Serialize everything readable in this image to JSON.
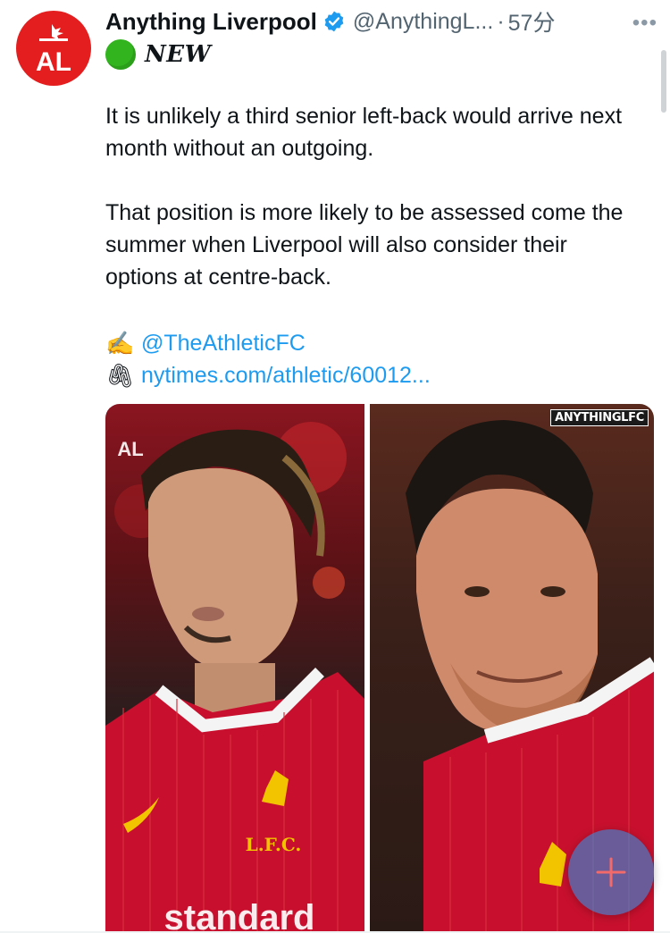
{
  "tweet": {
    "author": {
      "display_name": "Anything Liverpool",
      "handle": "@AnythingL...",
      "separator": "·",
      "time": "57分",
      "avatar_initials": "AL",
      "avatar_color": "#e41e1e"
    },
    "more_label": "•••",
    "badge_text": "NEW",
    "paragraphs": [
      "It is unlikely a third senior left-back would arrive next month without an outgoing.",
      "That position is more likely to be assessed come the summer when Liverpool will also consider their options at centre-back."
    ],
    "credit": {
      "writer_emoji": "✍️",
      "writer_link": "@TheAthleticFC",
      "link_emoji": "🖇",
      "url_text": "nytimes.com/athletic/60012..."
    },
    "media": {
      "watermark": "ANYTHINGLFC",
      "left_overlay_initials": "AL",
      "left_crest_text": "L.F.C.",
      "left_sponsor_text": "standard"
    }
  },
  "colors": {
    "link": "#1d9bf0",
    "accent_red": "#e41e1e",
    "secondary_text": "#536471",
    "verified": "#1d9bf0"
  },
  "compose_button": {
    "icon": "plus-icon"
  }
}
